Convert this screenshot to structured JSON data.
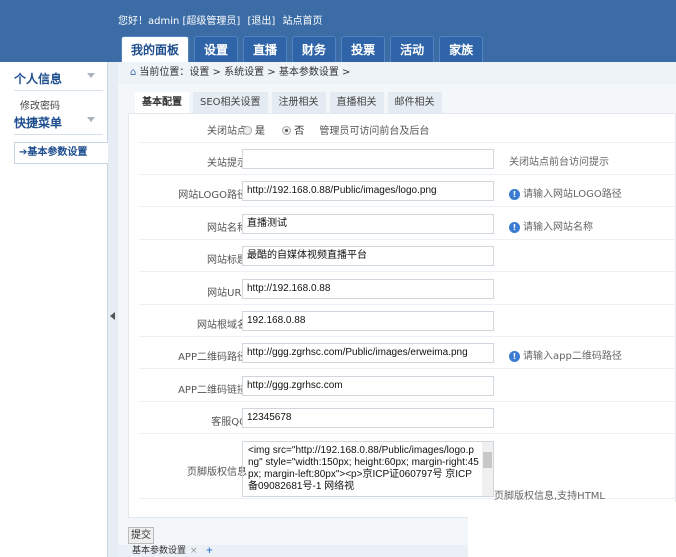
{
  "header": {
    "greeting": "您好！admin [超级管理员]",
    "logout": "[退出]",
    "home": "站点首页",
    "nav": [
      "我的面板",
      "设置",
      "直播",
      "财务",
      "投票",
      "活动",
      "家族"
    ],
    "active_nav": 0
  },
  "sidebar": {
    "sections": [
      {
        "title": "个人信息",
        "items": [
          "修改密码"
        ]
      },
      {
        "title": "快捷菜单",
        "items": [
          "基本参数设置"
        ]
      }
    ]
  },
  "breadcrumb": "当前位置：设置 > 系统设置 > 基本参数设置 >",
  "tabs": [
    "基本配置",
    "SEO相关设置",
    "注册相关",
    "直播相关",
    "邮件相关"
  ],
  "active_tab": 0,
  "form": {
    "close_site": {
      "label": "关闭站点",
      "yes": "是",
      "no": "否",
      "selected": "否",
      "hint": "管理员可访问前台及后台"
    },
    "fields": [
      {
        "label": "关站提示",
        "value": "",
        "hint": "关闭站点前台访问提示",
        "icon": false
      },
      {
        "label": "网站LOGO路径",
        "value": "http://192.168.0.88/Public/images/logo.png",
        "hint": "请输入网站LOGO路径",
        "icon": true
      },
      {
        "label": "网站名称",
        "value": "直播测试",
        "hint": "请输入网站名称",
        "icon": true
      },
      {
        "label": "网站标题",
        "value": "最酷的自媒体视频直播平台",
        "hint": "",
        "icon": false
      },
      {
        "label": "网站URL",
        "value": "http://192.168.0.88",
        "hint": "",
        "icon": false
      },
      {
        "label": "网站根域名",
        "value": "192.168.0.88",
        "hint": "",
        "icon": false
      },
      {
        "label": "APP二维码路径",
        "value": "http://ggg.zgrhsc.com/Public/images/erweima.png",
        "hint": "请输入app二维码路径",
        "icon": true
      },
      {
        "label": "APP二维码链接",
        "value": "http://ggg.zgrhsc.com",
        "hint": "",
        "icon": false
      },
      {
        "label": "客服QQ",
        "value": "12345678",
        "hint": "",
        "icon": false
      }
    ],
    "footer": {
      "label": "页脚版权信息",
      "value": "<img src=\"http://192.168.0.88/Public/images/logo.png\" style=\"width:150px; height:60px; margin-right:45px; margin-left:80px\"><p>京ICP证060797号 京ICP备09082681号-1 网络视",
      "hint": "页脚版权信息,支持HTML"
    },
    "submit": "提交"
  },
  "bottom_tabs": [
    {
      "label": "基本参数设置",
      "close": "×"
    }
  ],
  "add_tab": "+"
}
